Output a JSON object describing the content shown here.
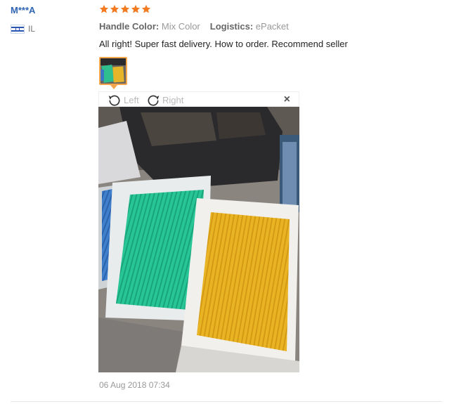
{
  "reviewer": {
    "name": "M***A",
    "country_code": "IL"
  },
  "rating": {
    "stars": 5,
    "max": 5,
    "color": "#f47a20"
  },
  "attributes": {
    "handle_color_label": "Handle Color:",
    "handle_color_value": "Mix Color",
    "logistics_label": "Logistics:",
    "logistics_value": "ePacket"
  },
  "review_text": "All right! Super fast delivery. How to order. Recommend seller",
  "image_viewer": {
    "rotate_left_label": "Left",
    "rotate_right_label": "Right",
    "close_label": "×"
  },
  "date": "06 Aug 2018 07:34",
  "colors": {
    "accent": "#f4a64d",
    "link": "#2e64b4"
  }
}
